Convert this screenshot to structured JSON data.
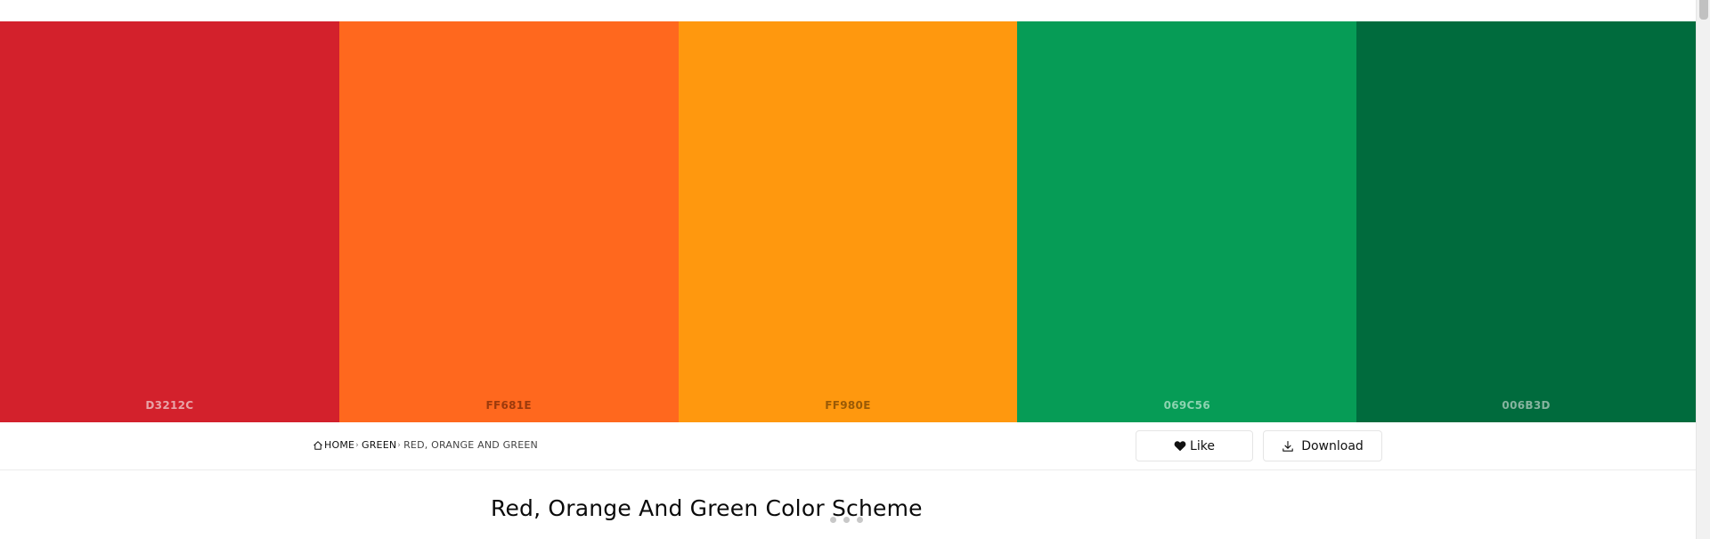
{
  "palette": {
    "swatches": [
      {
        "hex": "D3212C",
        "color": "#D3212C",
        "label_color": "#E8A3A7"
      },
      {
        "hex": "FF681E",
        "color": "#FF681E",
        "label_color": "#9C3A0C"
      },
      {
        "hex": "FF980E",
        "color": "#FF980E",
        "label_color": "#9A5A06"
      },
      {
        "hex": "069C56",
        "color": "#069C56",
        "label_color": "#8CD3B0"
      },
      {
        "hex": "006B3D",
        "color": "#006B3D",
        "label_color": "#86B49F"
      }
    ]
  },
  "breadcrumb": {
    "home": "HOME",
    "separator": "›",
    "green": "GREEN",
    "current": "RED, ORANGE AND GREEN"
  },
  "actions": {
    "like_label": "Like",
    "download_label": "Download"
  },
  "main": {
    "title": "Red, Orange And Green Color Scheme"
  },
  "icons": {
    "home": "home-icon",
    "like": "heart-icon",
    "download": "download-icon"
  }
}
